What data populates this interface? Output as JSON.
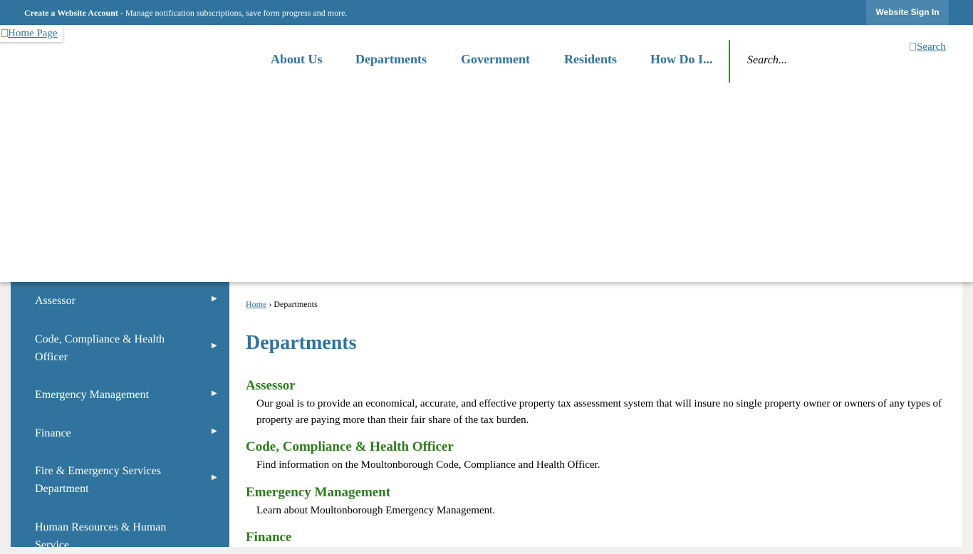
{
  "topbar": {
    "account_link_strong": "Create a Website Account",
    "account_link_rest": " - Manage notification subscriptions, save form progress and more.",
    "signin_label": "Website Sign In"
  },
  "header": {
    "logo_alt": "Home Page",
    "nav": [
      "About Us",
      "Departments",
      "Government",
      "Residents",
      "How Do I..."
    ],
    "search_placeholder": "Search...",
    "search_button": "Search"
  },
  "sidebar": {
    "items": [
      {
        "label": "Assessor"
      },
      {
        "label": "Code, Compliance & Health Officer"
      },
      {
        "label": "Emergency Management"
      },
      {
        "label": "Finance"
      },
      {
        "label": "Fire & Emergency Services Department"
      },
      {
        "label": "Human Resources & Human Service"
      }
    ],
    "arrow": "▶"
  },
  "main": {
    "breadcrumb_home": "Home",
    "breadcrumb_sep": " › ",
    "breadcrumb_current": "Departments",
    "title": "Departments",
    "departments": [
      {
        "name": "Assessor",
        "description": "Our goal is to provide an economical, accurate, and effective property tax assessment system that will insure no single property owner or owners of any types of property are paying more than their fair share of the tax burden."
      },
      {
        "name": "Code, Compliance & Health Officer",
        "description": "Find information on the Moultonborough Code, Compliance and Health Officer."
      },
      {
        "name": "Emergency Management",
        "description": "Learn about Moultonborough Emergency Management."
      },
      {
        "name": "Finance",
        "description": ""
      }
    ]
  },
  "colors": {
    "brand_blue": "#2f739e",
    "accent_green": "#2d7d1a"
  }
}
